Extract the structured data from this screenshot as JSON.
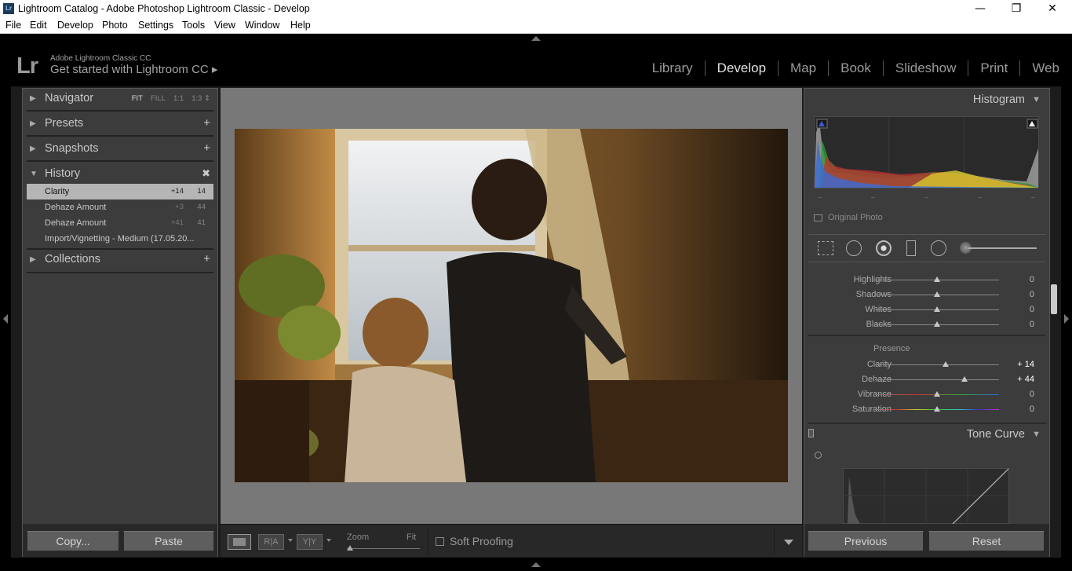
{
  "window": {
    "icon": "Lr",
    "title": "Lightroom Catalog - Adobe Photoshop Lightroom Classic - Develop",
    "minimize_icon": "minimize-icon",
    "restore_icon": "restore-icon",
    "close_icon": "close-icon"
  },
  "menu": [
    "File",
    "Edit",
    "Develop",
    "Photo",
    "Settings",
    "Tools",
    "View",
    "Window",
    "Help"
  ],
  "identity": {
    "logo": "Lr",
    "line1": "Adobe Lightroom Classic CC",
    "line2": "Get started with Lightroom CC ▸"
  },
  "modules": {
    "items": [
      "Library",
      "Develop",
      "Map",
      "Book",
      "Slideshow",
      "Print",
      "Web"
    ],
    "active": "Develop"
  },
  "left_panel": {
    "navigator": {
      "label": "Navigator",
      "options": [
        "FIT",
        "FILL",
        "1:1",
        "1:3 ⇕"
      ],
      "active": "FIT"
    },
    "presets": {
      "label": "Presets"
    },
    "snapshots": {
      "label": "Snapshots"
    },
    "history": {
      "label": "History",
      "clear_icon": "close-icon",
      "items": [
        {
          "name": "Clarity",
          "delta": "+14",
          "value": "14",
          "selected": true
        },
        {
          "name": "Dehaze Amount",
          "delta": "+3",
          "value": "44"
        },
        {
          "name": "Dehaze Amount",
          "delta": "+41",
          "value": "41"
        },
        {
          "name": "Import/Vignetting - Medium (17.05.20...",
          "delta": "",
          "value": ""
        }
      ]
    },
    "collections": {
      "label": "Collections"
    },
    "copy_label": "Copy...",
    "paste_label": "Paste"
  },
  "toolbar": {
    "view_icon": "loupe-view-icon",
    "before_after_icon": "before-after-icon",
    "ba_label": "R|A",
    "yy_label": "Y|Y",
    "zoom_label": "Zoom",
    "fit_label": "Fit",
    "zoom_level": 0.0,
    "soft_proofing_label": "Soft Proofing",
    "soft_proofing_checked": false
  },
  "right_panel": {
    "histogram": {
      "label": "Histogram",
      "original_photo_label": "Original Photo",
      "readout": [
        "–",
        "–",
        "–",
        "–",
        "–"
      ]
    },
    "tool_strip": [
      "crop-overlay-icon",
      "spot-removal-icon",
      "red-eye-icon",
      "graduated-filter-icon",
      "radial-filter-icon",
      "adjustment-brush-icon"
    ],
    "tone": [
      {
        "name": "Highlights",
        "value": "0",
        "level": 0.5
      },
      {
        "name": "Shadows",
        "value": "0",
        "level": 0.5
      },
      {
        "name": "Whites",
        "value": "0",
        "level": 0.5
      },
      {
        "name": "Blacks",
        "value": "0",
        "level": 0.5
      }
    ],
    "presence_label": "Presence",
    "presence": [
      {
        "name": "Clarity",
        "value": "+ 14",
        "level": 0.57
      },
      {
        "name": "Dehaze",
        "value": "+ 44",
        "level": 0.72
      },
      {
        "name": "Vibrance",
        "value": "0",
        "level": 0.5
      },
      {
        "name": "Saturation",
        "value": "0",
        "level": 0.5
      }
    ],
    "tone_curve_label": "Tone Curve",
    "previous_label": "Previous",
    "reset_label": "Reset"
  },
  "colors": {
    "panel": "#3c3c3c",
    "frame": "#1c1c1c",
    "center_bg": "#787878",
    "history_selected": "#b5b5b5"
  }
}
